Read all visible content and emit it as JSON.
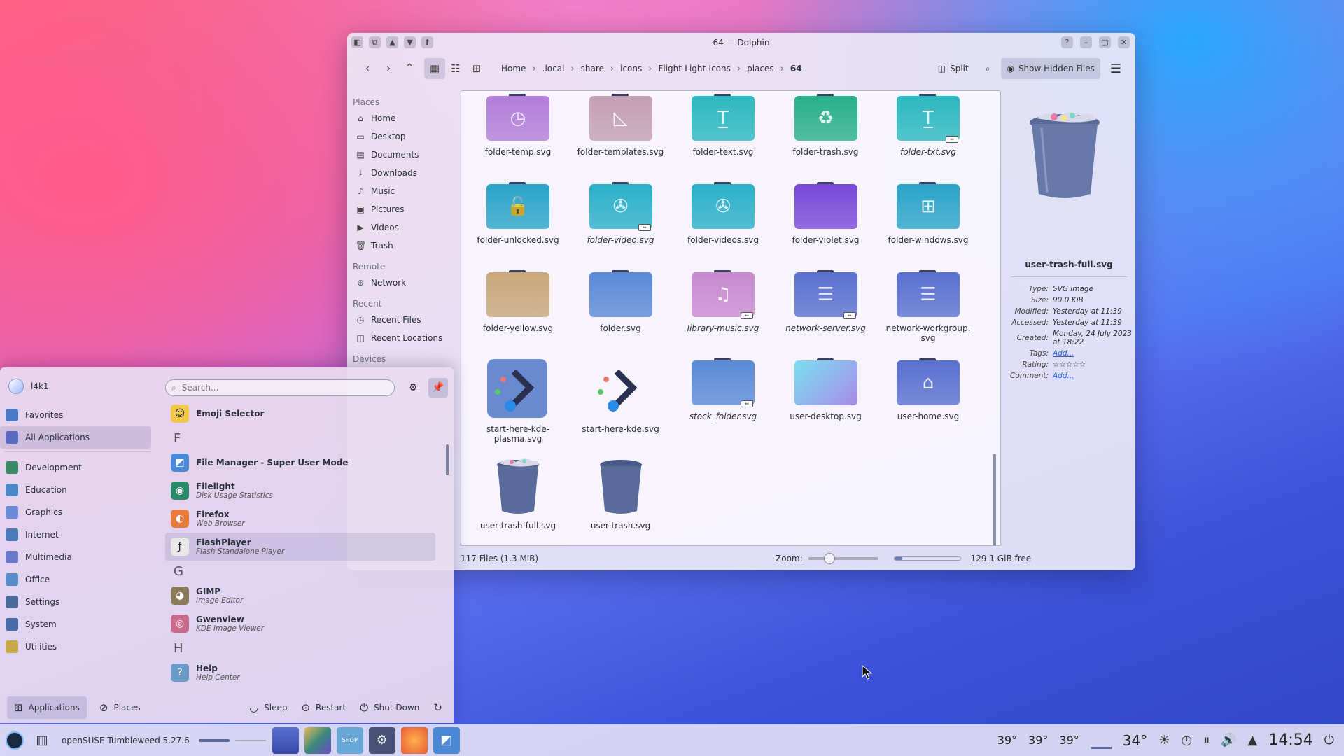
{
  "window": {
    "title": "64 — Dolphin",
    "breadcrumbs": [
      "Home",
      ".local",
      "share",
      "icons",
      "Flight-Light-Icons",
      "places",
      "64"
    ],
    "split_label": "Split",
    "hidden_files_label": "Show Hidden Files"
  },
  "places": {
    "sections": [
      {
        "header": "Places",
        "items": [
          {
            "label": "Home",
            "icon": "home-icon"
          },
          {
            "label": "Desktop",
            "icon": "desktop-icon"
          },
          {
            "label": "Documents",
            "icon": "documents-icon"
          },
          {
            "label": "Downloads",
            "icon": "download-icon"
          },
          {
            "label": "Music",
            "icon": "music-icon"
          },
          {
            "label": "Pictures",
            "icon": "pictures-icon"
          },
          {
            "label": "Videos",
            "icon": "videos-icon"
          },
          {
            "label": "Trash",
            "icon": "trash-icon"
          }
        ]
      },
      {
        "header": "Remote",
        "items": [
          {
            "label": "Network",
            "icon": "network-icon"
          }
        ]
      },
      {
        "header": "Recent",
        "items": [
          {
            "label": "Recent Files",
            "icon": "recent-files-icon"
          },
          {
            "label": "Recent Locations",
            "icon": "recent-locations-icon"
          }
        ]
      },
      {
        "header": "Devices",
        "items": []
      }
    ]
  },
  "files": [
    {
      "name": "folder-temp.svg",
      "italic": false,
      "color": "#b27ed8",
      "symbol": "clock"
    },
    {
      "name": "folder-templates.svg",
      "italic": false,
      "color": "#c4a0b4",
      "symbol": "template"
    },
    {
      "name": "folder-text.svg",
      "italic": false,
      "color": "#2cb8c0",
      "symbol": "text"
    },
    {
      "name": "folder-trash.svg",
      "italic": false,
      "color": "#28b08a",
      "symbol": "recycle"
    },
    {
      "name": "folder-txt.svg",
      "italic": true,
      "color": "#2cb8c0",
      "symbol": "text",
      "link": true
    },
    {
      "name": "folder-unlocked.svg",
      "italic": false,
      "color": "#2aa4c8",
      "symbol": "unlock"
    },
    {
      "name": "folder-video.svg",
      "italic": true,
      "color": "#2ab0c8",
      "symbol": "film",
      "link": true
    },
    {
      "name": "folder-videos.svg",
      "italic": false,
      "color": "#2ab0c8",
      "symbol": "film"
    },
    {
      "name": "folder-violet.svg",
      "italic": false,
      "color": "#7a48d8",
      "symbol": ""
    },
    {
      "name": "folder-windows.svg",
      "italic": false,
      "color": "#2aa4c8",
      "symbol": "windows"
    },
    {
      "name": "folder-yellow.svg",
      "italic": false,
      "color": "#c8a87a",
      "symbol": ""
    },
    {
      "name": "folder.svg",
      "italic": false,
      "color": "#5a8ad8",
      "symbol": ""
    },
    {
      "name": "library-music.svg",
      "italic": true,
      "color": "#c88ad0",
      "symbol": "music",
      "link": true
    },
    {
      "name": "network-server.svg",
      "italic": true,
      "color": "#5a70d0",
      "symbol": "server",
      "link": true
    },
    {
      "name": "network-workgroup.svg",
      "italic": false,
      "color": "#5a70d0",
      "symbol": "server"
    },
    {
      "name": "start-here-kde-plasma.svg",
      "italic": false,
      "color": "#6a8ad0",
      "symbol": "kde"
    },
    {
      "name": "start-here-kde.svg",
      "italic": false,
      "color": "",
      "symbol": "kde2"
    },
    {
      "name": "stock_folder.svg",
      "italic": true,
      "color": "#5a8ad8",
      "symbol": "",
      "link": true
    },
    {
      "name": "user-desktop.svg",
      "italic": false,
      "color": "#58b8e8",
      "symbol": "desktop"
    },
    {
      "name": "user-home.svg",
      "italic": false,
      "color": "#5a70d0",
      "symbol": "home"
    },
    {
      "name": "user-trash-full.svg",
      "italic": false,
      "color": "",
      "symbol": "trashfull"
    },
    {
      "name": "user-trash.svg",
      "italic": false,
      "color": "",
      "symbol": "trash"
    }
  ],
  "info": {
    "filename": "user-trash-full.svg",
    "rows": [
      {
        "key": "Type:",
        "value": "SVG image"
      },
      {
        "key": "Size:",
        "value": "90.0 KiB"
      },
      {
        "key": "Modified:",
        "value": "Yesterday at 11:39"
      },
      {
        "key": "Accessed:",
        "value": "Yesterday at 11:39"
      },
      {
        "key": "Created:",
        "value": "Monday, 24 July 2023 at 18:22"
      },
      {
        "key": "Tags:",
        "value": "Add...",
        "link": true
      },
      {
        "key": "Rating:",
        "value": "☆☆☆☆☆"
      },
      {
        "key": "Comment:",
        "value": "Add...",
        "link": true
      }
    ]
  },
  "status": {
    "count": "117 Files (1.3 MiB)",
    "zoom_label": "Zoom:",
    "zoom_level": 0.3,
    "disk_used": 0.12,
    "free": "129.1 GiB free"
  },
  "launcher": {
    "user": "l4k1",
    "search_placeholder": "Search...",
    "categories": [
      {
        "label": "Favorites",
        "color": "#4a78c8",
        "selected": false
      },
      {
        "label": "All Applications",
        "color": "#5a6ac0",
        "selected": true
      },
      {
        "label": "Development",
        "color": "#3a8a6a",
        "selected": false
      },
      {
        "label": "Education",
        "color": "#4a88c8",
        "selected": false
      },
      {
        "label": "Graphics",
        "color": "#6a8ad8",
        "selected": false
      },
      {
        "label": "Internet",
        "color": "#4a7ab8",
        "selected": false
      },
      {
        "label": "Multimedia",
        "color": "#6a7ac8",
        "selected": false
      },
      {
        "label": "Office",
        "color": "#5a8ac8",
        "selected": false
      },
      {
        "label": "Settings",
        "color": "#4a6a98",
        "selected": false
      },
      {
        "label": "System",
        "color": "#4a6aa8",
        "selected": false
      },
      {
        "label": "Utilities",
        "color": "#c8a84a",
        "selected": false
      }
    ],
    "apps": [
      {
        "type": "app",
        "name": "Emoji Selector",
        "desc": "",
        "color": "#f2c84a",
        "glyph": "☺"
      },
      {
        "type": "letter",
        "name": "F"
      },
      {
        "type": "app",
        "name": "File Manager - Super User Mode",
        "desc": "",
        "color": "#4a88d8",
        "glyph": "◩"
      },
      {
        "type": "app",
        "name": "Filelight",
        "desc": "Disk Usage Statistics",
        "color": "#2a8a6a",
        "glyph": "◉"
      },
      {
        "type": "app",
        "name": "Firefox",
        "desc": "Web Browser",
        "color": "#e87a3a",
        "glyph": "◐"
      },
      {
        "type": "app",
        "name": "FlashPlayer",
        "desc": "Flash Standalone Player",
        "color": "#e8e8e8",
        "glyph": "ƒ",
        "hl": true
      },
      {
        "type": "letter",
        "name": "G"
      },
      {
        "type": "app",
        "name": "GIMP",
        "desc": "Image Editor",
        "color": "#8a7a5a",
        "glyph": "◕"
      },
      {
        "type": "app",
        "name": "Gwenview",
        "desc": "KDE Image Viewer",
        "color": "#c86a8a",
        "glyph": "◎"
      },
      {
        "type": "letter",
        "name": "H"
      },
      {
        "type": "app",
        "name": "Help",
        "desc": "Help Center",
        "color": "#6a9ac8",
        "glyph": "?"
      }
    ],
    "bottom": {
      "applications": "Applications",
      "places": "Places",
      "sleep": "Sleep",
      "restart": "Restart",
      "shutdown": "Shut Down"
    }
  },
  "panel": {
    "task_title": "openSUSE Tumbleweed 5.27.6",
    "temps": [
      "39°",
      "39°",
      "39°"
    ],
    "weather": "34°",
    "clock": "14:54"
  }
}
